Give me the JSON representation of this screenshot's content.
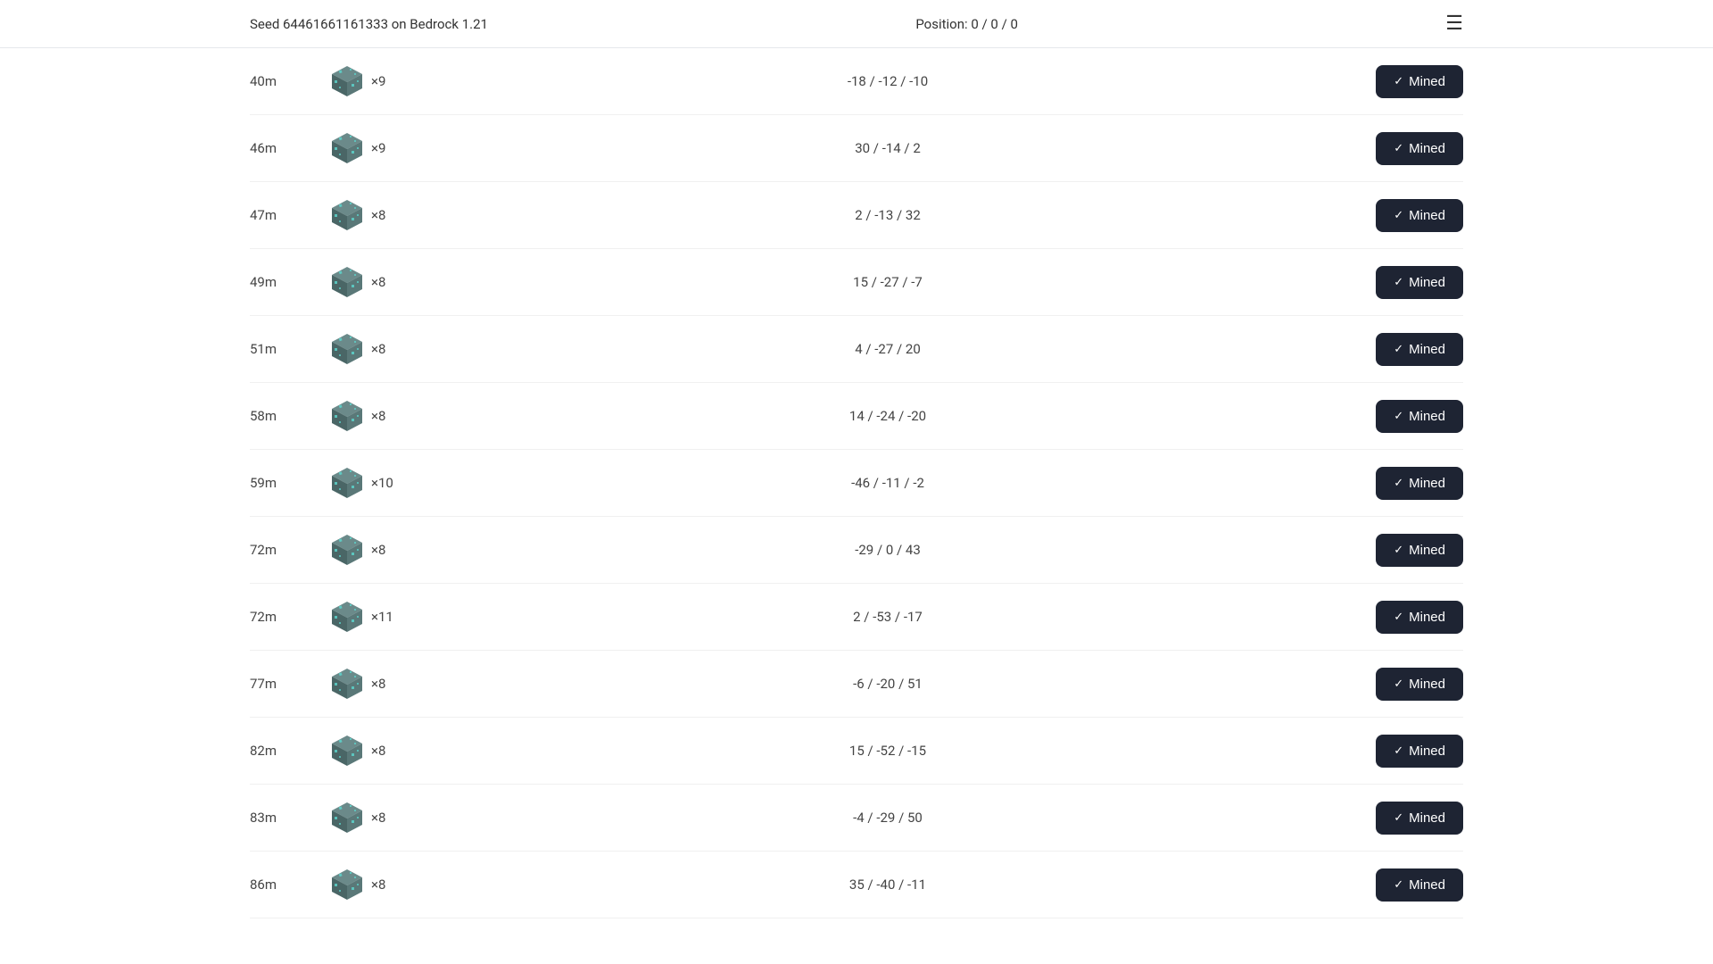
{
  "header": {
    "seed_label": "Seed 64461661161333 on Bedrock 1.21",
    "position_label": "Position: 0 / 0 / 0",
    "menu_icon": "☰"
  },
  "rows": [
    {
      "distance": "40m",
      "count": "×9",
      "position": "-18 / -12 / -10",
      "button_label": "Mined"
    },
    {
      "distance": "46m",
      "count": "×9",
      "position": "30 / -14 / 2",
      "button_label": "Mined"
    },
    {
      "distance": "47m",
      "count": "×8",
      "position": "2 / -13 / 32",
      "button_label": "Mined"
    },
    {
      "distance": "49m",
      "count": "×8",
      "position": "15 / -27 / -7",
      "button_label": "Mined"
    },
    {
      "distance": "51m",
      "count": "×8",
      "position": "4 / -27 / 20",
      "button_label": "Mined"
    },
    {
      "distance": "58m",
      "count": "×8",
      "position": "14 / -24 / -20",
      "button_label": "Mined"
    },
    {
      "distance": "59m",
      "count": "×10",
      "position": "-46 / -11 / -2",
      "button_label": "Mined"
    },
    {
      "distance": "72m",
      "count": "×8",
      "position": "-29 / 0 / 43",
      "button_label": "Mined"
    },
    {
      "distance": "72m",
      "count": "×11",
      "position": "2 / -53 / -17",
      "button_label": "Mined"
    },
    {
      "distance": "77m",
      "count": "×8",
      "position": "-6 / -20 / 51",
      "button_label": "Mined"
    },
    {
      "distance": "82m",
      "count": "×8",
      "position": "15 / -52 / -15",
      "button_label": "Mined"
    },
    {
      "distance": "83m",
      "count": "×8",
      "position": "-4 / -29 / 50",
      "button_label": "Mined"
    },
    {
      "distance": "86m",
      "count": "×8",
      "position": "35 / -40 / -11",
      "button_label": "Mined"
    }
  ],
  "button": {
    "check_symbol": "✓"
  }
}
